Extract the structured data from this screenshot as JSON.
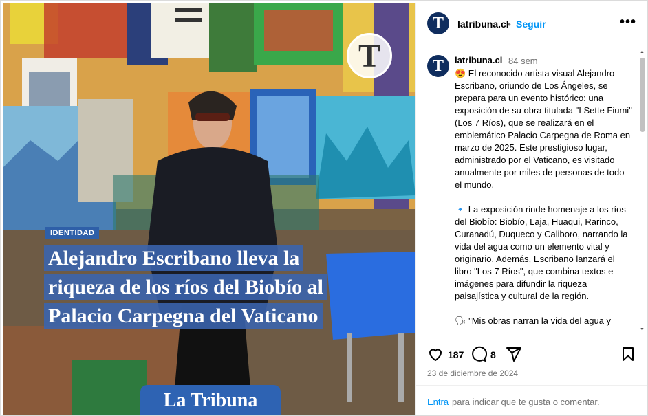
{
  "post": {
    "image": {
      "tag": "IDENTIDAD",
      "headline_lines": [
        "Alejandro Escribano lleva la",
        "riqueza de los ríos del Biobío al",
        "Palacio Carpegna del Vaticano"
      ],
      "brand_footer": "La Tribuna",
      "brand_badge": "T"
    },
    "header": {
      "avatar_letter": "T",
      "username": "latribuna.cl",
      "dot": "•",
      "follow": "Seguir",
      "more": "•••"
    },
    "caption": {
      "avatar_letter": "T",
      "username": "latribuna.cl",
      "time": "84 sem",
      "text": "😍 El reconocido artista visual Alejandro Escribano, oriundo de Los Ángeles, se prepara para un evento histórico: una exposición de su obra titulada \"I Sette Fiumi\" (Los 7 Ríos), que se realizará en el emblemático Palacio Carpegna de Roma en marzo de 2025. Este prestigioso lugar, administrado por el Vaticano, es visitado anualmente por miles de personas de todo el mundo.\n\n🔹 La exposición rinde homenaje a los ríos del Biobío: Biobío, Laja, Huaqui, Rarinco, Curanadú, Duqueco y Caliboro, narrando la vida del agua como un elemento vital y originario. Además, Escribano lanzará el libro \"Los 7 Ríos\", que combina textos e imágenes para difundir la riqueza paisajística y cultural de la región.\n\n🗣 \"Mis obras narran la vida del agua y"
    },
    "actions": {
      "likes": "187",
      "comments": "8"
    },
    "date": "23 de diciembre de 2024",
    "comment_box": {
      "link": "Entra",
      "rest": "para indicar que te gusta o comentar."
    }
  },
  "colors": {
    "link_blue": "#0095f6",
    "brand_navy": "#0f2d5e",
    "headline_bg": "#3a64af"
  },
  "icons": [
    "heart-icon",
    "comment-icon",
    "share-icon",
    "bookmark-icon",
    "more-icon"
  ]
}
